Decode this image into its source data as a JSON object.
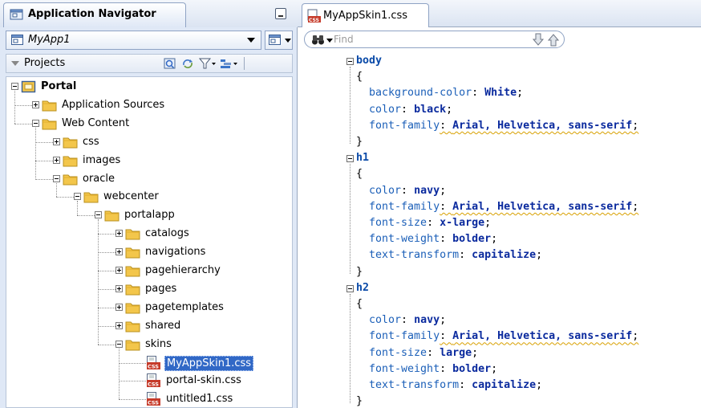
{
  "navigator": {
    "title": "Application Navigator",
    "app_selector": {
      "value": "MyApp1"
    },
    "projects_label": "Projects",
    "toolbar_icons": [
      "refresh-icon",
      "sync-icon",
      "filter-icon",
      "options-icon"
    ]
  },
  "tree": [
    {
      "label": "Portal",
      "level": 0,
      "icon": "project-icon",
      "expander": "minus",
      "bold": true
    },
    {
      "label": "Application Sources",
      "level": 1,
      "icon": "folder-icon",
      "expander": "plus"
    },
    {
      "label": "Web Content",
      "level": 1,
      "icon": "folder-icon",
      "expander": "minus"
    },
    {
      "label": "css",
      "level": 2,
      "icon": "folder-icon",
      "expander": "plus"
    },
    {
      "label": "images",
      "level": 2,
      "icon": "folder-icon",
      "expander": "plus"
    },
    {
      "label": "oracle",
      "level": 2,
      "icon": "folder-icon",
      "expander": "minus"
    },
    {
      "label": "webcenter",
      "level": 3,
      "icon": "folder-icon",
      "expander": "minus"
    },
    {
      "label": "portalapp",
      "level": 4,
      "icon": "folder-icon",
      "expander": "minus"
    },
    {
      "label": "catalogs",
      "level": 5,
      "icon": "folder-icon",
      "expander": "plus"
    },
    {
      "label": "navigations",
      "level": 5,
      "icon": "folder-icon",
      "expander": "plus"
    },
    {
      "label": "pagehierarchy",
      "level": 5,
      "icon": "folder-icon",
      "expander": "plus"
    },
    {
      "label": "pages",
      "level": 5,
      "icon": "folder-icon",
      "expander": "plus"
    },
    {
      "label": "pagetemplates",
      "level": 5,
      "icon": "folder-icon",
      "expander": "plus"
    },
    {
      "label": "shared",
      "level": 5,
      "icon": "folder-icon",
      "expander": "plus"
    },
    {
      "label": "skins",
      "level": 5,
      "icon": "folder-icon",
      "expander": "minus"
    },
    {
      "label": "MyAppSkin1.css",
      "level": 6,
      "icon": "css-file-icon",
      "expander": "none",
      "selected": true
    },
    {
      "label": "portal-skin.css",
      "level": 6,
      "icon": "css-file-icon",
      "expander": "none"
    },
    {
      "label": "untitled1.css",
      "level": 6,
      "icon": "css-file-icon",
      "expander": "none"
    }
  ],
  "editor": {
    "tab_title": "MyAppSkin1.css",
    "find_placeholder": "Find",
    "code": [
      {
        "fold": true,
        "tokens": [
          {
            "t": "body",
            "c": "selector"
          }
        ]
      },
      {
        "tokens": [
          {
            "t": "{",
            "c": ""
          }
        ]
      },
      {
        "tokens": [
          {
            "t": "  background-color",
            "c": "prop"
          },
          {
            "t": ": ",
            "c": ""
          },
          {
            "t": "White",
            "c": "val"
          },
          {
            "t": ";",
            "c": ""
          }
        ]
      },
      {
        "tokens": [
          {
            "t": "  color",
            "c": "prop"
          },
          {
            "t": ": ",
            "c": ""
          },
          {
            "t": "black",
            "c": "val"
          },
          {
            "t": ";",
            "c": ""
          }
        ]
      },
      {
        "tokens": [
          {
            "t": "  font-family",
            "c": "prop"
          },
          {
            "t": ": ",
            "c": "squig"
          },
          {
            "t": "Arial, Helvetica, sans-serif",
            "c": "val squig"
          },
          {
            "t": ";",
            "c": "squig"
          }
        ]
      },
      {
        "tokens": [
          {
            "t": "}",
            "c": ""
          }
        ]
      },
      {
        "fold": true,
        "tokens": [
          {
            "t": "h1",
            "c": "selector"
          }
        ]
      },
      {
        "tokens": [
          {
            "t": "{",
            "c": ""
          }
        ]
      },
      {
        "tokens": [
          {
            "t": "  color",
            "c": "prop"
          },
          {
            "t": ": ",
            "c": ""
          },
          {
            "t": "navy",
            "c": "val"
          },
          {
            "t": ";",
            "c": ""
          }
        ]
      },
      {
        "tokens": [
          {
            "t": "  font-family",
            "c": "prop"
          },
          {
            "t": ": ",
            "c": "squig"
          },
          {
            "t": "Arial, Helvetica, sans-serif",
            "c": "val squig"
          },
          {
            "t": ";",
            "c": "squig"
          }
        ]
      },
      {
        "tokens": [
          {
            "t": "  font-size",
            "c": "prop"
          },
          {
            "t": ": ",
            "c": ""
          },
          {
            "t": "x-large",
            "c": "val"
          },
          {
            "t": ";",
            "c": ""
          }
        ]
      },
      {
        "tokens": [
          {
            "t": "  font-weight",
            "c": "prop"
          },
          {
            "t": ": ",
            "c": ""
          },
          {
            "t": "bolder",
            "c": "val"
          },
          {
            "t": ";",
            "c": ""
          }
        ]
      },
      {
        "tokens": [
          {
            "t": "  text-transform",
            "c": "prop"
          },
          {
            "t": ": ",
            "c": ""
          },
          {
            "t": "capitalize",
            "c": "val"
          },
          {
            "t": ";",
            "c": ""
          }
        ]
      },
      {
        "tokens": [
          {
            "t": "}",
            "c": ""
          }
        ]
      },
      {
        "fold": true,
        "tokens": [
          {
            "t": "h2",
            "c": "selector"
          }
        ]
      },
      {
        "tokens": [
          {
            "t": "{",
            "c": ""
          }
        ]
      },
      {
        "tokens": [
          {
            "t": "  color",
            "c": "prop"
          },
          {
            "t": ": ",
            "c": ""
          },
          {
            "t": "navy",
            "c": "val"
          },
          {
            "t": ";",
            "c": ""
          }
        ]
      },
      {
        "tokens": [
          {
            "t": "  font-family",
            "c": "prop"
          },
          {
            "t": ": ",
            "c": "squig"
          },
          {
            "t": "Arial, Helvetica, sans-serif",
            "c": "val squig"
          },
          {
            "t": ";",
            "c": "squig"
          }
        ]
      },
      {
        "tokens": [
          {
            "t": "  font-size",
            "c": "prop"
          },
          {
            "t": ": ",
            "c": ""
          },
          {
            "t": "large",
            "c": "val"
          },
          {
            "t": ";",
            "c": ""
          }
        ]
      },
      {
        "tokens": [
          {
            "t": "  font-weight",
            "c": "prop"
          },
          {
            "t": ": ",
            "c": ""
          },
          {
            "t": "bolder",
            "c": "val"
          },
          {
            "t": ";",
            "c": ""
          }
        ]
      },
      {
        "tokens": [
          {
            "t": "  text-transform",
            "c": "prop"
          },
          {
            "t": ": ",
            "c": ""
          },
          {
            "t": "capitalize",
            "c": "val"
          },
          {
            "t": ";",
            "c": ""
          }
        ]
      },
      {
        "tokens": [
          {
            "t": "}",
            "c": ""
          }
        ]
      }
    ]
  },
  "colors": {
    "panel_bg": "#dfe8f6",
    "selection": "#3168c6",
    "selector_blue": "#0a4aa8",
    "property_blue": "#1b5fb8",
    "value_navy": "#0a2a9e",
    "folder_yellow": "#f3c64b"
  }
}
